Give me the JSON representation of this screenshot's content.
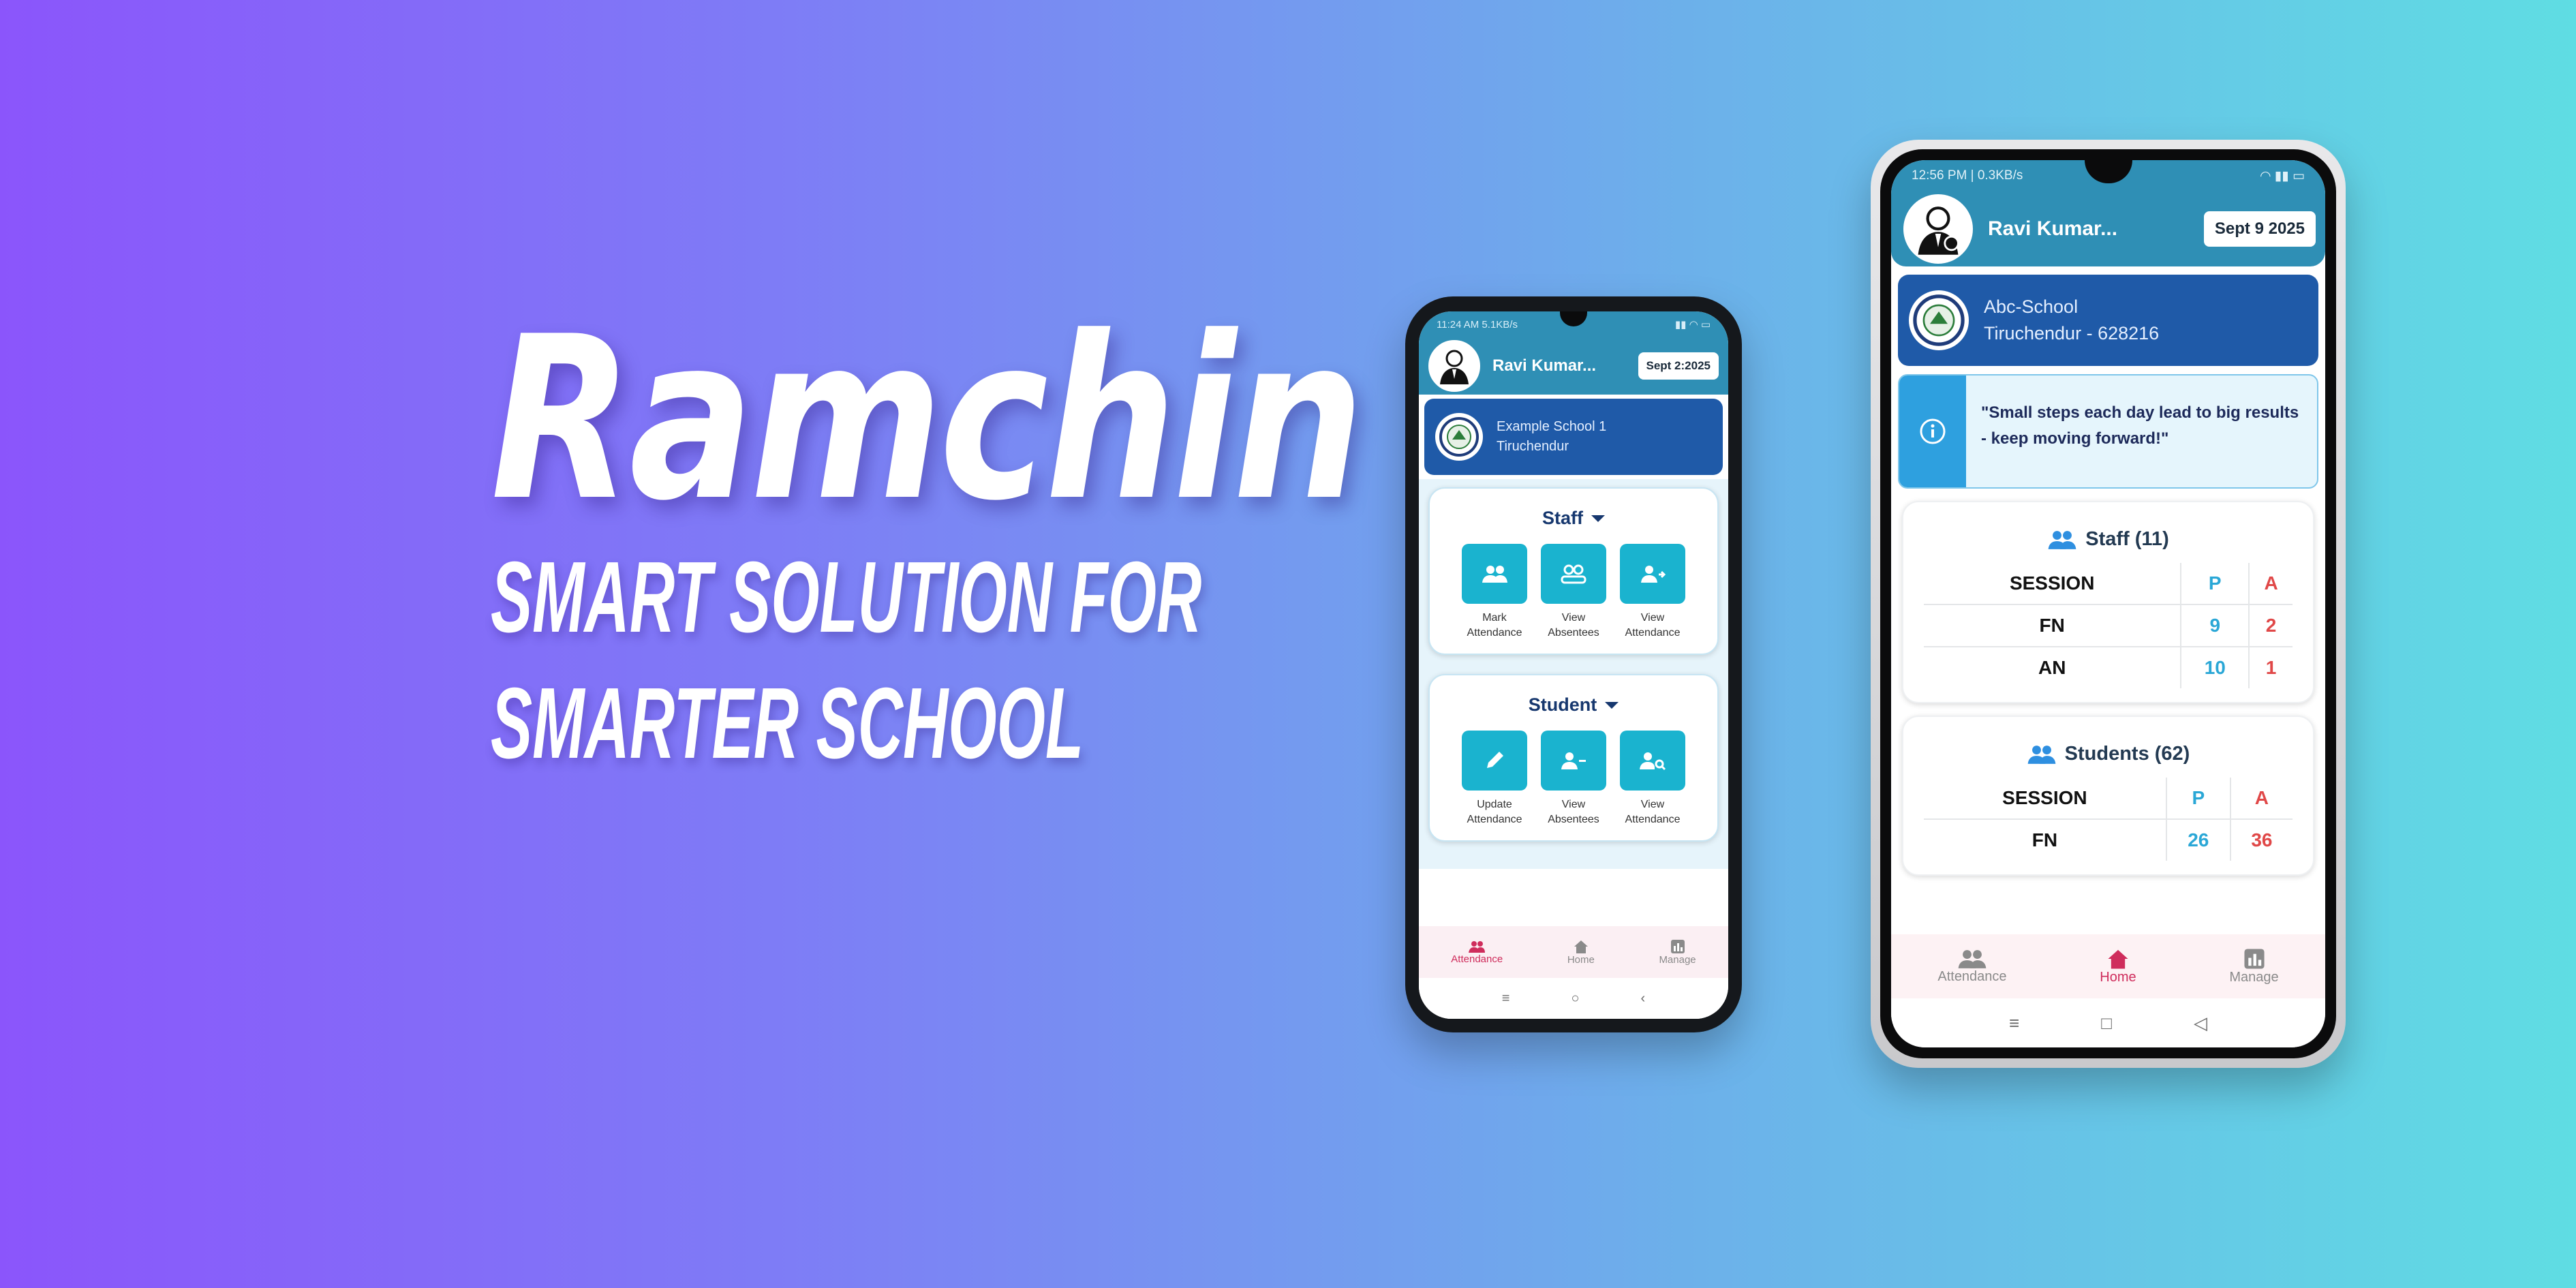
{
  "hero": {
    "title": "Ramchin",
    "subtitle_line1": "SMART SOLUTION FOR",
    "subtitle_line2": "SMARTER SCHOOL"
  },
  "colors": {
    "accent": "#2f8fb5",
    "school_card": "#1f5aa8",
    "tile": "#1ab3cf",
    "active_nav": "#cf2d5c",
    "present": "#2aa7d6",
    "absent": "#e04848"
  },
  "phone1": {
    "status_left": "11:24 AM  5.1KB/s",
    "user_name": "Ravi Kumar...",
    "date": "Sept 2:2025",
    "school": {
      "name": "Example School 1",
      "place": "Tiruchendur"
    },
    "staff": {
      "title": "Staff",
      "tiles": [
        {
          "label_1": "Mark",
          "label_2": "Attendance",
          "icon": "group-icon"
        },
        {
          "label_1": "View",
          "label_2": "Absentees",
          "icon": "absentees-icon"
        },
        {
          "label_1": "View",
          "label_2": "Attendance",
          "icon": "person-arrow-icon"
        }
      ]
    },
    "student": {
      "title": "Student",
      "tiles": [
        {
          "label_1": "Update",
          "label_2": "Attendance",
          "icon": "pencil-icon"
        },
        {
          "label_1": "View",
          "label_2": "Absentees",
          "icon": "person-minus-icon"
        },
        {
          "label_1": "View",
          "label_2": "Attendance",
          "icon": "person-search-icon"
        }
      ]
    },
    "nav": {
      "attendance": "Attendance",
      "home": "Home",
      "manage": "Manage"
    }
  },
  "phone2": {
    "status_left": "12:56 PM | 0.3KB/s",
    "user_name": "Ravi Kumar...",
    "date": "Sept 9 2025",
    "school": {
      "name": "Abc-School",
      "place": "Tiruchendur - 628216"
    },
    "quote_line1": "\"Small steps each day lead to big results",
    "quote_line2": "- keep moving forward!\"",
    "staff_table": {
      "title": "Staff (11)",
      "headers": [
        "SESSION",
        "P",
        "A"
      ],
      "rows": [
        [
          "FN",
          "9",
          "2"
        ],
        [
          "AN",
          "10",
          "1"
        ]
      ]
    },
    "students_table": {
      "title": "Students (62)",
      "headers": [
        "SESSION",
        "P",
        "A"
      ],
      "rows": [
        [
          "FN",
          "26",
          "36"
        ]
      ]
    },
    "nav": {
      "attendance": "Attendance",
      "home": "Home",
      "manage": "Manage"
    }
  }
}
